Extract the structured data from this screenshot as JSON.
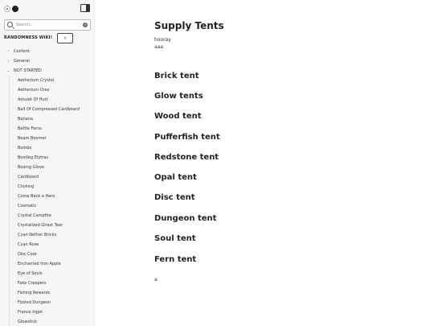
{
  "sidebar": {
    "search": {
      "placeholder": "Search..."
    },
    "wiki_title": "RANDOMNESS WIKI!",
    "sections": [
      {
        "label": "Content",
        "arrow": "›"
      },
      {
        "label": "General",
        "arrow": "›"
      },
      {
        "label": "NOT STARTED",
        "arrow": "⌄"
      }
    ],
    "items": [
      "Aetherium Crystal",
      "Aetherium Ores",
      "Amulet Of Hurt",
      "Ball Of Compressed Cardboard",
      "Banana",
      "Battle Ferns",
      "Beam Boomer",
      "Bombs",
      "Bootleg Elytras",
      "Boxing Glove",
      "Cardboard",
      "Choking",
      "Come Back a Hero",
      "Cosmatic",
      "Crystal Campfire",
      "Crystalized Ghast Tear",
      "Cyan Nether Bricks",
      "Cyan Rose",
      "Disc Core",
      "Enchanted Iron Apple",
      "Eye of Souls",
      "Fake Creepers",
      "Fishing Rewards",
      "Fizzled Dungeon",
      "France Ingot",
      "Glowstick"
    ]
  },
  "main": {
    "title": "Supply Tents",
    "intro": [
      "hooray",
      "aaa"
    ],
    "headings": [
      "Brick tent",
      "Glow tents",
      "Wood tent",
      "Pufferfish tent",
      "Redstone tent",
      "Opal tent",
      "Disc tent",
      "Dungeon tent",
      "Soul tent",
      "Fern tent"
    ],
    "footer_text": "a"
  }
}
